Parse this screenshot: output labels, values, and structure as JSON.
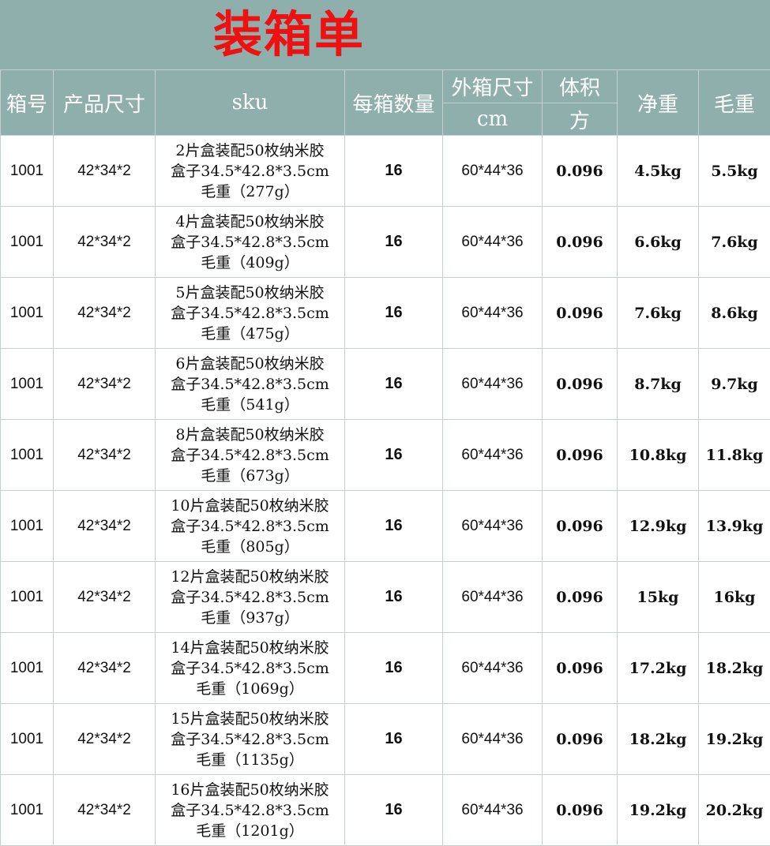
{
  "title": "装箱单",
  "headers": {
    "box_no": "箱号",
    "product_size": "产品尺寸",
    "sku": "sku",
    "qty_per_box": "每箱数量",
    "outer_size_line1": "外箱尺寸",
    "outer_size_line2": "cm",
    "volume_line1": "体积",
    "volume_line2": "方",
    "net_weight": "净重",
    "gross_weight": "毛重"
  },
  "rows": [
    {
      "box_no": "1001",
      "size": "42*34*2",
      "sku1": "2片盒装配50枚纳米胶",
      "sku2": "盒子34.5*42.8*3.5cm",
      "sku3": "毛重（277g）",
      "qty": "16",
      "outer": "60*44*36",
      "volume": "0.096",
      "net": "4.5kg",
      "gross": "5.5kg"
    },
    {
      "box_no": "1001",
      "size": "42*34*2",
      "sku1": "4片盒装配50枚纳米胶",
      "sku2": "盒子34.5*42.8*3.5cm",
      "sku3": "毛重（409g）",
      "qty": "16",
      "outer": "60*44*36",
      "volume": "0.096",
      "net": "6.6kg",
      "gross": "7.6kg"
    },
    {
      "box_no": "1001",
      "size": "42*34*2",
      "sku1": "5片盒装配50枚纳米胶",
      "sku2": "盒子34.5*42.8*3.5cm",
      "sku3": "毛重（475g）",
      "qty": "16",
      "outer": "60*44*36",
      "volume": "0.096",
      "net": "7.6kg",
      "gross": "8.6kg"
    },
    {
      "box_no": "1001",
      "size": "42*34*2",
      "sku1": "6片盒装配50枚纳米胶",
      "sku2": "盒子34.5*42.8*3.5cm",
      "sku3": "毛重（541g）",
      "qty": "16",
      "outer": "60*44*36",
      "volume": "0.096",
      "net": "8.7kg",
      "gross": "9.7kg"
    },
    {
      "box_no": "1001",
      "size": "42*34*2",
      "sku1": "8片盒装配50枚纳米胶",
      "sku2": "盒子34.5*42.8*3.5cm",
      "sku3": "毛重（673g）",
      "qty": "16",
      "outer": "60*44*36",
      "volume": "0.096",
      "net": "10.8kg",
      "gross": "11.8kg"
    },
    {
      "box_no": "1001",
      "size": "42*34*2",
      "sku1": "10片盒装配50枚纳米胶",
      "sku2": "盒子34.5*42.8*3.5cm",
      "sku3": "毛重（805g）",
      "qty": "16",
      "outer": "60*44*36",
      "volume": "0.096",
      "net": "12.9kg",
      "gross": "13.9kg"
    },
    {
      "box_no": "1001",
      "size": "42*34*2",
      "sku1": "12片盒装配50枚纳米胶",
      "sku2": "盒子34.5*42.8*3.5cm",
      "sku3": "毛重（937g）",
      "qty": "16",
      "outer": "60*44*36",
      "volume": "0.096",
      "net": "15kg",
      "gross": "16kg"
    },
    {
      "box_no": "1001",
      "size": "42*34*2",
      "sku1": "14片盒装配50枚纳米胶",
      "sku2": "盒子34.5*42.8*3.5cm",
      "sku3": "毛重（1069g）",
      "qty": "16",
      "outer": "60*44*36",
      "volume": "0.096",
      "net": "17.2kg",
      "gross": "18.2kg"
    },
    {
      "box_no": "1001",
      "size": "42*34*2",
      "sku1": "15片盒装配50枚纳米胶",
      "sku2": "盒子34.5*42.8*3.5cm",
      "sku3": "毛重（1135g）",
      "qty": "16",
      "outer": "60*44*36",
      "volume": "0.096",
      "net": "18.2kg",
      "gross": "19.2kg"
    },
    {
      "box_no": "1001",
      "size": "42*34*2",
      "sku1": "16片盒装配50枚纳米胶",
      "sku2": "盒子34.5*42.8*3.5cm",
      "sku3": "毛重（1201g）",
      "qty": "16",
      "outer": "60*44*36",
      "volume": "0.096",
      "net": "19.2kg",
      "gross": "20.2kg"
    }
  ],
  "colors": {
    "header_bg": "#8fafad",
    "title_red": "#ee1111",
    "grid_line": "#c6d0cf"
  }
}
